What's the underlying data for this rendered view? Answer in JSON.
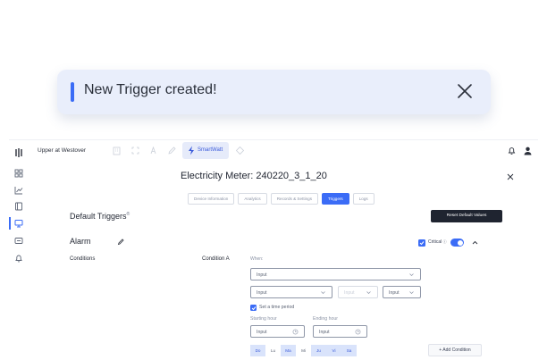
{
  "toast": {
    "message": "New Trigger created!"
  },
  "topbar": {
    "location": "Upper at Westover",
    "app_name": "SmartWatt"
  },
  "main": {
    "title": "Electricity Meter: 240220_3_1_20",
    "tabs": [
      {
        "label": "Device Information",
        "active": false
      },
      {
        "label": "Analytics",
        "active": false
      },
      {
        "label": "Records & Settings",
        "active": false
      },
      {
        "label": "Triggers",
        "active": true
      },
      {
        "label": "Logs",
        "active": false
      }
    ],
    "section_title": "Default Triggers",
    "reset_label": "Reset Default Values",
    "alarm_title": "Alarm",
    "critical_label": "Critical",
    "conditions_label": "Conditions",
    "condition_name": "Condition A",
    "when_label": "When:",
    "input_placeholder": "Input",
    "time_period_label": "Set a time period",
    "starting_hour_label": "Starting hour",
    "ending_hour_label": "Ending hour",
    "days": [
      {
        "label": "Do",
        "selected": true
      },
      {
        "label": "Lu",
        "selected": false
      },
      {
        "label": "Ma",
        "selected": true
      },
      {
        "label": "Mi",
        "selected": false
      },
      {
        "label": "Ju",
        "selected": true
      },
      {
        "label": "Vi",
        "selected": true
      },
      {
        "label": "Sa",
        "selected": true
      }
    ],
    "add_condition_label": "+ Add Condition"
  },
  "colors": {
    "accent": "#3b6cf6",
    "toast_bg": "#e9eefb",
    "dark_button": "#1f2430"
  }
}
